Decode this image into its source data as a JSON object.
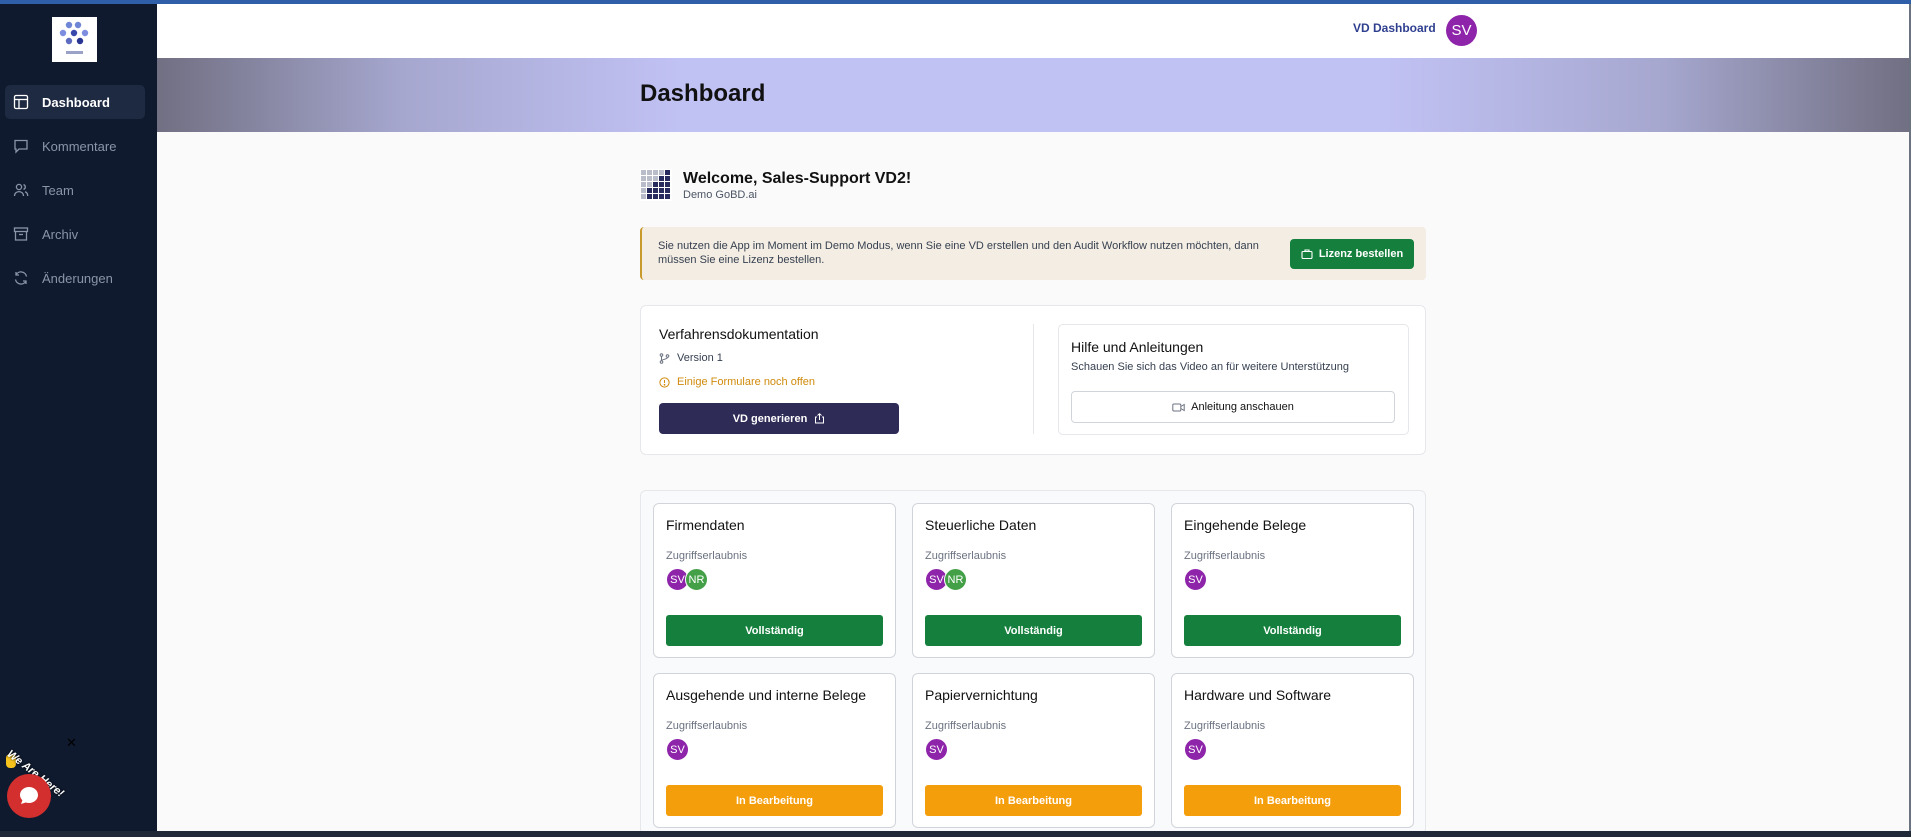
{
  "sidebar": {
    "items": [
      {
        "label": "Dashboard",
        "icon": "layout-icon",
        "active": true
      },
      {
        "label": "Kommentare",
        "icon": "comment-icon"
      },
      {
        "label": "Team",
        "icon": "users-icon"
      },
      {
        "label": "Archiv",
        "icon": "archive-icon"
      },
      {
        "label": "Änderungen",
        "icon": "refresh-icon"
      }
    ]
  },
  "chat": {
    "banner": "We Are Here!"
  },
  "topbar": {
    "link": "VD Dashboard",
    "avatar": "SV"
  },
  "hero": {
    "title": "Dashboard"
  },
  "welcome": {
    "title": "Welcome, Sales-Support VD2!",
    "subtitle": "Demo GoBD.ai"
  },
  "demo_alert": {
    "text": "Sie nutzen die App im Moment im Demo Modus, wenn Sie eine VD erstellen und den Audit Workflow nutzen möchten, dann müssen Sie eine Lizenz bestellen.",
    "button": "Lizenz bestellen"
  },
  "vd": {
    "title": "Verfahrensdokumentation",
    "version": "Version 1",
    "warning": "Einige Formulare noch offen",
    "button": "VD generieren"
  },
  "help": {
    "title": "Hilfe und Anleitungen",
    "subtitle": "Schauen Sie sich das Video an für weitere Unterstützung",
    "button": "Anleitung anschauen"
  },
  "sections": [
    {
      "title": "Firmendaten",
      "perm": "Zugriffserlaubnis",
      "avatars": [
        "SV",
        "NR"
      ],
      "status": "Vollständig"
    },
    {
      "title": "Steuerliche Daten",
      "perm": "Zugriffserlaubnis",
      "avatars": [
        "SV",
        "NR"
      ],
      "status": "Vollständig"
    },
    {
      "title": "Eingehende Belege",
      "perm": "Zugriffserlaubnis",
      "avatars": [
        "SV"
      ],
      "status": "Vollständig"
    },
    {
      "title": "Ausgehende und interne Belege",
      "perm": "Zugriffserlaubnis",
      "avatars": [
        "SV"
      ],
      "status": "In Bearbeitung"
    },
    {
      "title": "Papiervernichtung",
      "perm": "Zugriffserlaubnis",
      "avatars": [
        "SV"
      ],
      "status": "In Bearbeitung"
    },
    {
      "title": "Hardware und Software",
      "perm": "Zugriffserlaubnis",
      "avatars": [
        "SV"
      ],
      "status": "In Bearbeitung"
    }
  ],
  "colors": {
    "sidebar_bg": "#0f1a2e",
    "complete": "#15803d",
    "in_progress": "#f59e0b",
    "avatar_sv": "#8e24aa",
    "avatar_nr": "#43a047",
    "primary_dark": "#2e2b57"
  }
}
